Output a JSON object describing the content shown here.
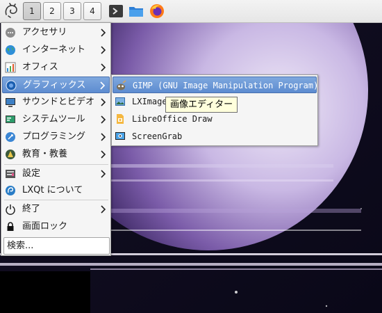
{
  "desktops": [
    "1",
    "2",
    "3",
    "4"
  ],
  "quicklaunch": [
    "terminal-icon",
    "file-manager-icon",
    "firefox-icon"
  ],
  "main_menu": {
    "items": [
      {
        "label": "アクセサリ",
        "icon": "accessories-icon"
      },
      {
        "label": "インターネット",
        "icon": "internet-globe-icon"
      },
      {
        "label": "オフィス",
        "icon": "office-icon"
      },
      {
        "label": "グラフィックス",
        "icon": "graphics-icon"
      },
      {
        "label": "サウンドとビデオ",
        "icon": "multimedia-icon"
      },
      {
        "label": "システムツール",
        "icon": "system-tools-icon"
      },
      {
        "label": "プログラミング",
        "icon": "programming-icon"
      },
      {
        "label": "教育・教養",
        "icon": "education-icon"
      },
      {
        "label": "設定",
        "icon": "settings-icon"
      },
      {
        "label": "LXQt について",
        "icon": "lxqt-about-icon"
      },
      {
        "label": "終了",
        "icon": "power-icon"
      },
      {
        "label": "画面ロック",
        "icon": "lock-icon"
      }
    ],
    "search_label": "検索..."
  },
  "graphics_submenu": {
    "items": [
      {
        "label": "GIMP (GNU Image Manipulation Program)",
        "icon": "gimp-icon"
      },
      {
        "label": "LXImage",
        "icon": "image-viewer-icon"
      },
      {
        "label": "LibreOffice Draw",
        "icon": "libreoffice-draw-icon"
      },
      {
        "label": "ScreenGrab",
        "icon": "screengrab-icon"
      }
    ]
  },
  "tooltip": "画像エディター",
  "colors": {
    "highlight": "#6a97d6",
    "panel": "#ececec",
    "menu_bg": "#f5f5f5"
  }
}
